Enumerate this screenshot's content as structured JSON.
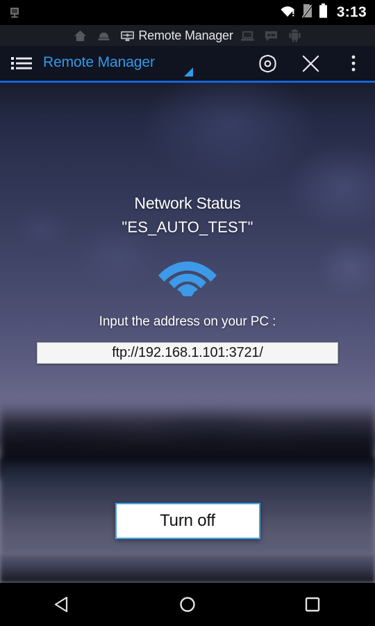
{
  "status_bar": {
    "notification_icon": "cast-screen-icon",
    "wifi_icon": "wifi-warning-icon",
    "sim_icon": "no-sim-icon",
    "battery_icon": "battery-full-icon",
    "clock": "3:13"
  },
  "tab_bar": {
    "tabs": [
      {
        "name": "home",
        "icon": "home-icon",
        "label": "",
        "active": false
      },
      {
        "name": "cloud",
        "icon": "cloud-drive-icon",
        "label": "",
        "active": false
      },
      {
        "name": "remote-manager",
        "icon": "remote-monitor-icon",
        "label": "Remote Manager",
        "active": true
      },
      {
        "name": "computer",
        "icon": "laptop-icon",
        "label": "",
        "active": false
      },
      {
        "name": "messages",
        "icon": "message-bubble-icon",
        "label": "",
        "active": false
      },
      {
        "name": "apps",
        "icon": "android-robot-icon",
        "label": "",
        "active": false
      }
    ]
  },
  "toolbar": {
    "menu_icon": "list-menu-icon",
    "title": "Remote Manager",
    "settings_icon": "gear-icon",
    "close_icon": "close-icon",
    "overflow_icon": "more-vertical-icon",
    "accent_color": "#2f9bec",
    "rule_color": "#1565d8"
  },
  "main": {
    "network_status_label": "Network Status",
    "ssid": "\"ES_AUTO_TEST\"",
    "wifi_icon": "wifi-icon",
    "wifi_color": "#3d9ae8",
    "address_hint": "Input the address on your PC :",
    "address_value": "ftp://192.168.1.101:3721/",
    "turn_off_label": "Turn off",
    "turn_off_border_color": "#3da5e8"
  },
  "nav_bar": {
    "back_icon": "back-triangle-icon",
    "home_icon": "home-circle-icon",
    "recents_icon": "recents-square-icon"
  }
}
